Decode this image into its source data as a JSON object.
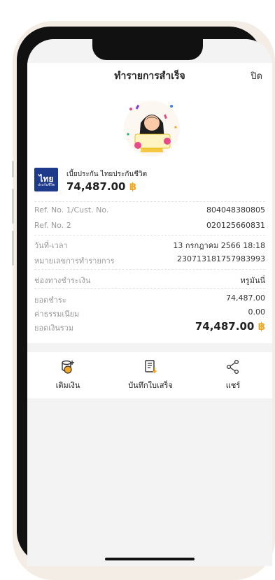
{
  "header": {
    "title": "ทำรายการสำเร็จ",
    "close_label": "ปิด"
  },
  "payee": {
    "logo_text": "ไทย",
    "logo_subtext": "ประกันชีวิต",
    "name": "เบี้ยประกัน ไทยประกันชีวิต",
    "amount": "74,487.00",
    "currency_symbol": "฿"
  },
  "details": [
    {
      "label": "Ref. No. 1/Cust. No.",
      "value": "804048380805"
    },
    {
      "label": "Ref. No. 2",
      "value": "020125660831"
    },
    {
      "label": "วันที่-เวลา",
      "value": "13 กรกฎาคม 2566 18:18"
    },
    {
      "label": "หมายเลขการทำรายการ",
      "value": "230713181757983993"
    },
    {
      "label": "ช่องทางชำระเงิน",
      "value": "ทรูมันนี่"
    },
    {
      "label": "ยอดชำระ",
      "value": "74,487.00"
    },
    {
      "label": "ค่าธรรมเนียม",
      "value": "0.00"
    },
    {
      "label": "ยอดเงินรวม",
      "value": "74,487.00"
    }
  ],
  "actions": [
    {
      "label": "เติมเงิน",
      "icon": "coins-add-icon"
    },
    {
      "label": "บันทึกใบเสร็จ",
      "icon": "receipt-download-icon"
    },
    {
      "label": "แชร์",
      "icon": "share-icon"
    }
  ],
  "colors": {
    "accent": "#f5a623",
    "logo_bg": "#1e3a8a"
  }
}
